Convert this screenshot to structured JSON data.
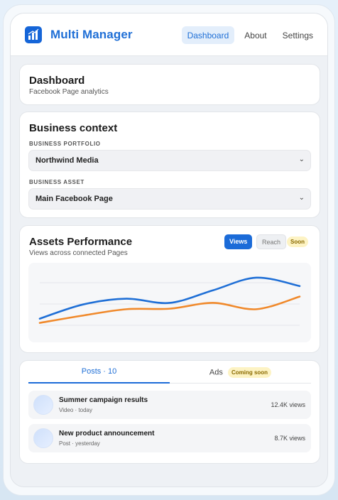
{
  "app": {
    "title": "Multi Manager",
    "logo_icon": "bar-chart-icon",
    "brand_color": "#1f6fd6"
  },
  "nav": {
    "items": [
      "Dashboard",
      "About",
      "Settings"
    ],
    "active": "Dashboard"
  },
  "header": {
    "title": "Dashboard",
    "subtitle": "Facebook Page analytics"
  },
  "business_context": {
    "title": "Business context",
    "portfolio_label": "BUSINESS PORTFOLIO",
    "portfolio_value": "Northwind Media",
    "asset_label": "BUSINESS ASSET",
    "asset_value": "Main Facebook Page"
  },
  "performance": {
    "title": "Assets Performance",
    "subtitle": "Views across connected Pages",
    "toggle": {
      "views": "Views",
      "reach": "Reach",
      "soon": "Soon"
    }
  },
  "chart_data": {
    "type": "line",
    "title": "",
    "xlabel": "",
    "ylabel": "",
    "grid": true,
    "x": [
      0,
      1,
      2,
      3,
      4,
      5,
      6
    ],
    "ylim": [
      0,
      100
    ],
    "series": [
      {
        "color": "#1f6fd6",
        "values": [
          18,
          45,
          56,
          48,
          72,
          96,
          80
        ]
      },
      {
        "color": "#f0892b",
        "values": [
          10,
          24,
          36,
          37,
          48,
          36,
          60
        ]
      }
    ]
  },
  "content": {
    "tabs": {
      "posts": "Posts · 10",
      "ads": "Ads",
      "ads_badge": "Coming soon"
    },
    "posts": [
      {
        "title": "Summer campaign results",
        "meta": "Video · today",
        "views": "12.4K views"
      },
      {
        "title": "New product announcement",
        "meta": "Post · yesterday",
        "views": "8.7K views"
      }
    ]
  }
}
